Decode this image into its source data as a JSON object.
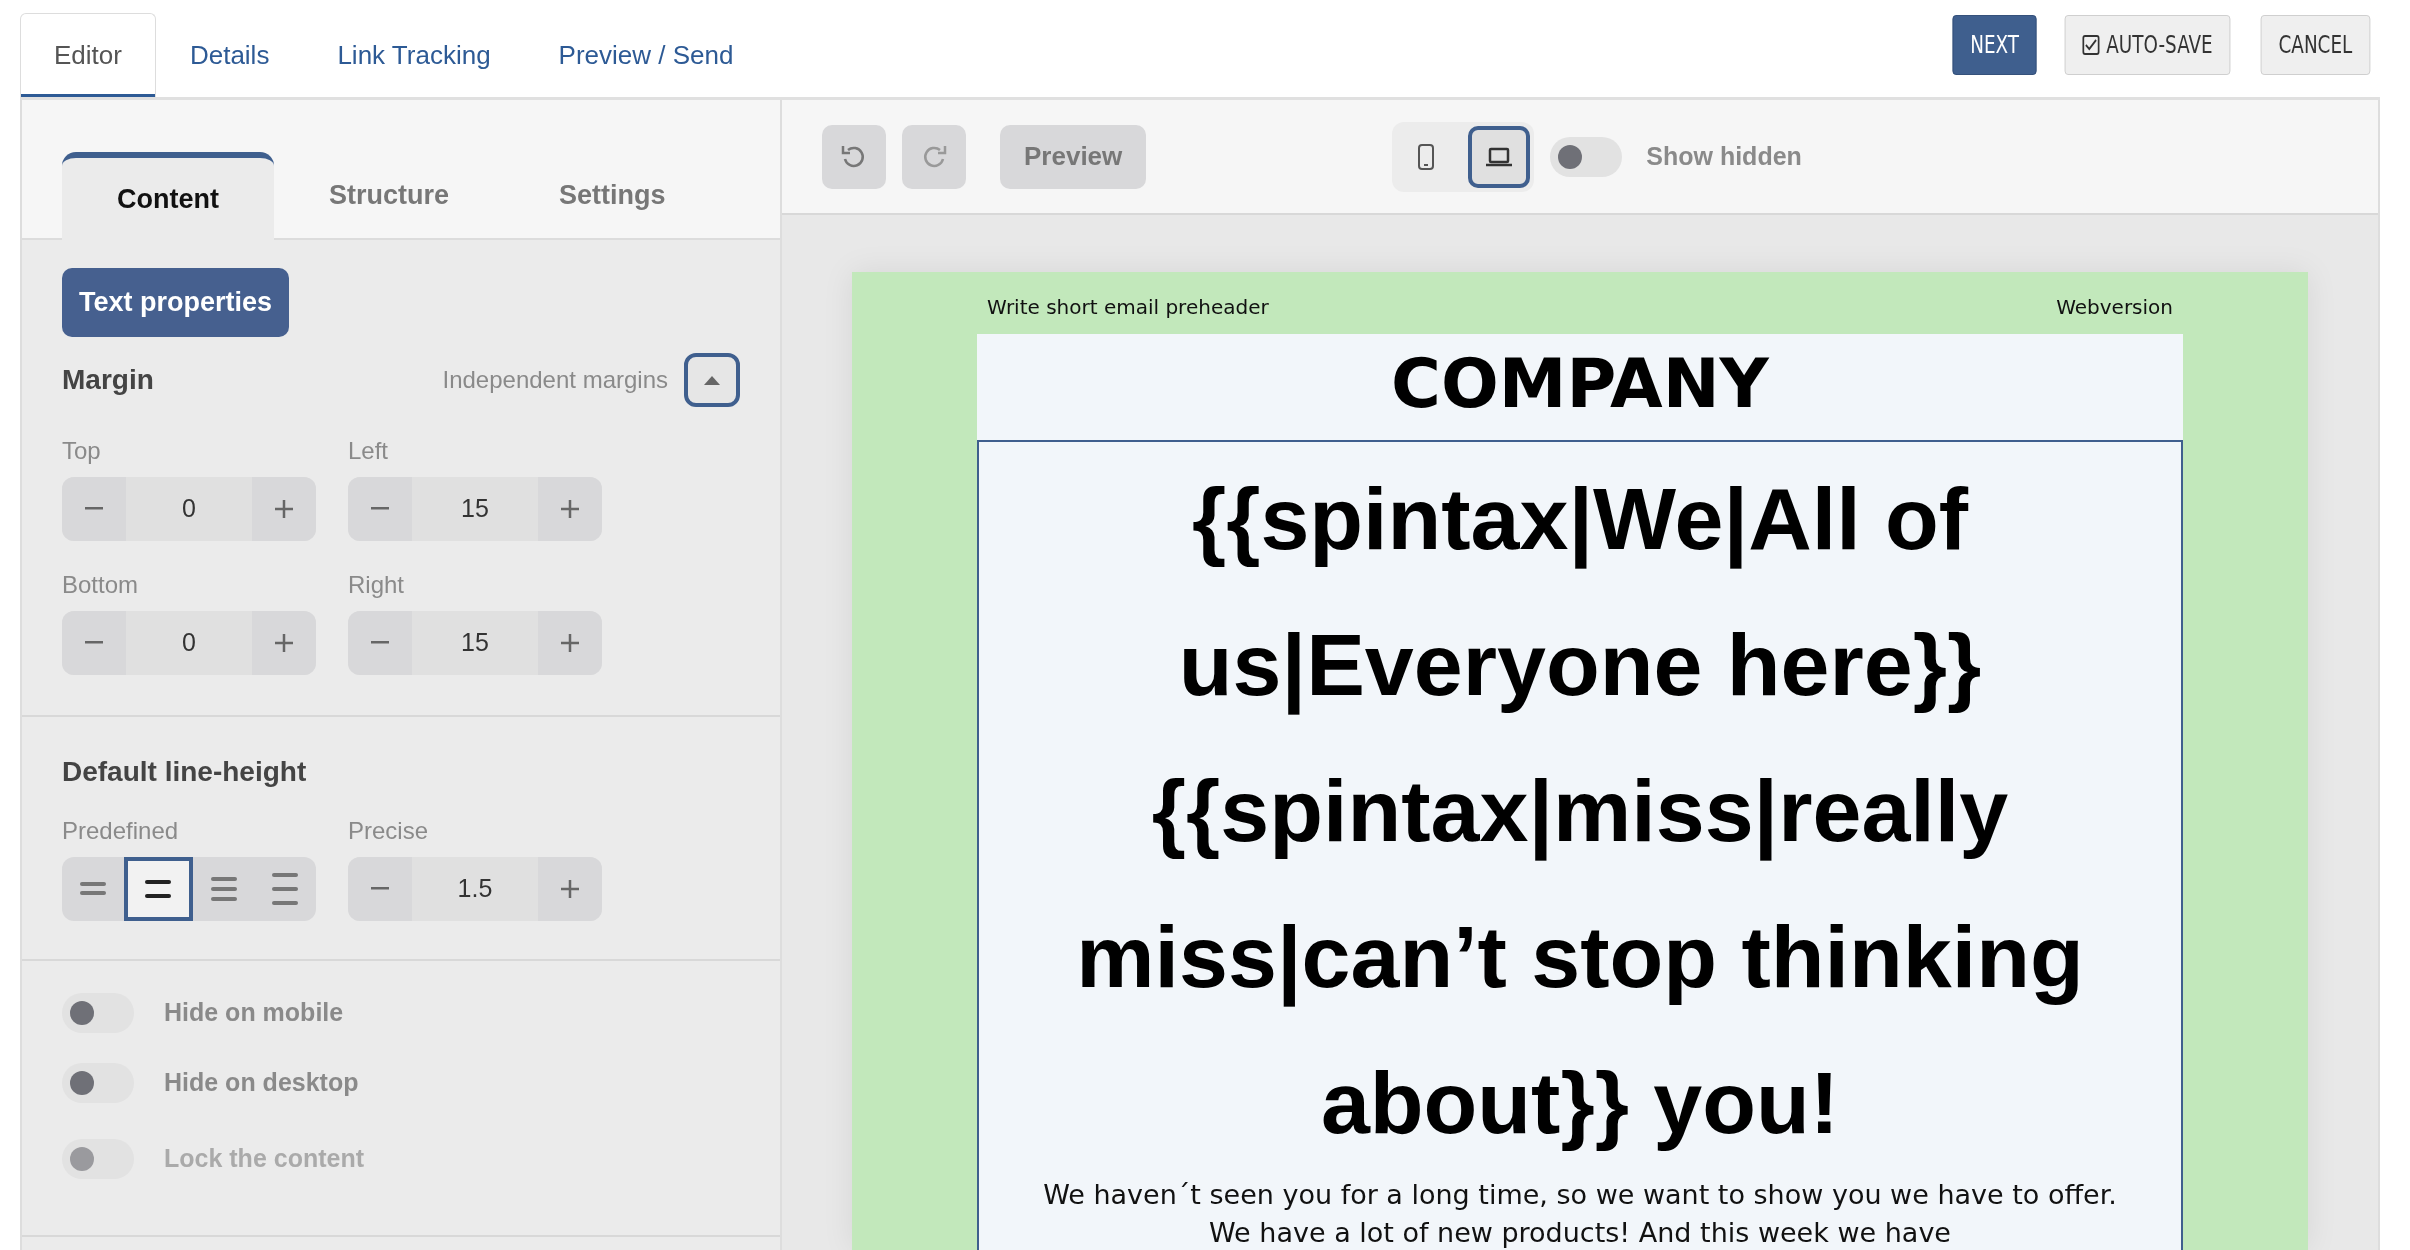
{
  "top_tabs": [
    {
      "label": "Editor",
      "selected": true
    },
    {
      "label": "Details",
      "selected": false
    },
    {
      "label": "Link Tracking",
      "selected": false
    },
    {
      "label": "Preview / Send",
      "selected": false
    }
  ],
  "actions": [
    {
      "label": "NEXT",
      "kind": "primary"
    },
    {
      "label": "AUTO-SAVE",
      "kind": "autosave",
      "checked": true
    },
    {
      "label": "CANCEL",
      "kind": "plain"
    }
  ],
  "panel_tabs": [
    {
      "label": "Content",
      "selected": true
    },
    {
      "label": "Structure",
      "selected": false
    },
    {
      "label": "Settings",
      "selected": false
    }
  ],
  "section_button": "Text properties",
  "margin": {
    "title": "Margin",
    "independent_label": "Independent margins",
    "expanded": true,
    "fields": [
      {
        "label": "Top",
        "value": "0"
      },
      {
        "label": "Left",
        "value": "15"
      },
      {
        "label": "Bottom",
        "value": "0"
      },
      {
        "label": "Right",
        "value": "15"
      }
    ]
  },
  "line_height": {
    "title": "Default line-height",
    "predefined_label": "Predefined",
    "options": [
      {
        "kind": "tight",
        "selected": false
      },
      {
        "kind": "normal",
        "selected": true
      },
      {
        "kind": "relaxed",
        "selected": false
      },
      {
        "kind": "loose",
        "selected": false
      }
    ],
    "precise_label": "Precise",
    "precise_value": "1.5"
  },
  "toggles": [
    {
      "label": "Hide on mobile",
      "on": false,
      "disabled": false
    },
    {
      "label": "Hide on desktop",
      "on": false,
      "disabled": false
    },
    {
      "label": "Lock the content",
      "on": false,
      "disabled": true
    }
  ],
  "toolbar": {
    "preview": "Preview",
    "devices": [
      {
        "kind": "mobile",
        "selected": false
      },
      {
        "kind": "desktop",
        "selected": true
      }
    ],
    "show_hidden": {
      "label": "Show hidden",
      "on": false
    }
  },
  "email": {
    "preheader": "Write short email preheader",
    "webversion": "Webversion",
    "company": "COMPANY",
    "heading": "{{spintax|We|All of us|Everyone here}} {{spintax|miss|really miss|can’t stop thinking about}} you!",
    "paragraph_lines": [
      "We haven´t seen you for a long time, so we want to show you we have to offer.",
      "We have a lot of new products! And this week we have"
    ]
  }
}
